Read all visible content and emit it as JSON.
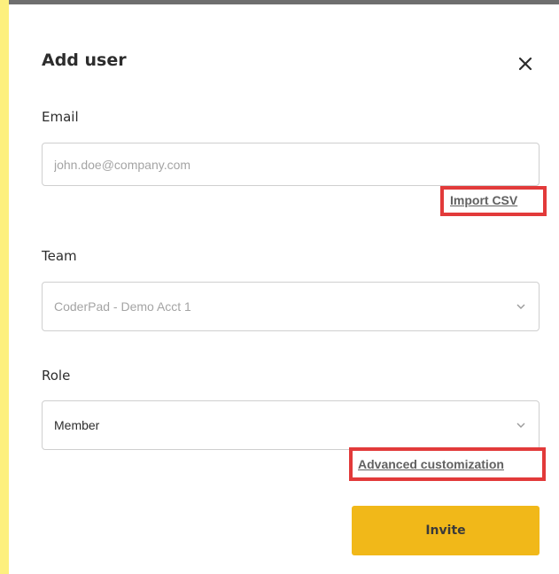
{
  "dialog": {
    "title": "Add user",
    "close_icon": "close-icon"
  },
  "email": {
    "label": "Email",
    "placeholder": "john.doe@company.com",
    "value": "",
    "import_link": "Import CSV"
  },
  "team": {
    "label": "Team",
    "selected": "CoderPad - Demo Acct 1",
    "chevron_icon": "chevron-down-icon"
  },
  "role": {
    "label": "Role",
    "selected": "Member",
    "chevron_icon": "chevron-down-icon",
    "advanced_link": "Advanced customization"
  },
  "actions": {
    "invite_label": "Invite"
  },
  "colors": {
    "background": "#fdf07e",
    "accent_button": "#f1b819",
    "highlight": "#e23a3a",
    "link": "#616161"
  }
}
